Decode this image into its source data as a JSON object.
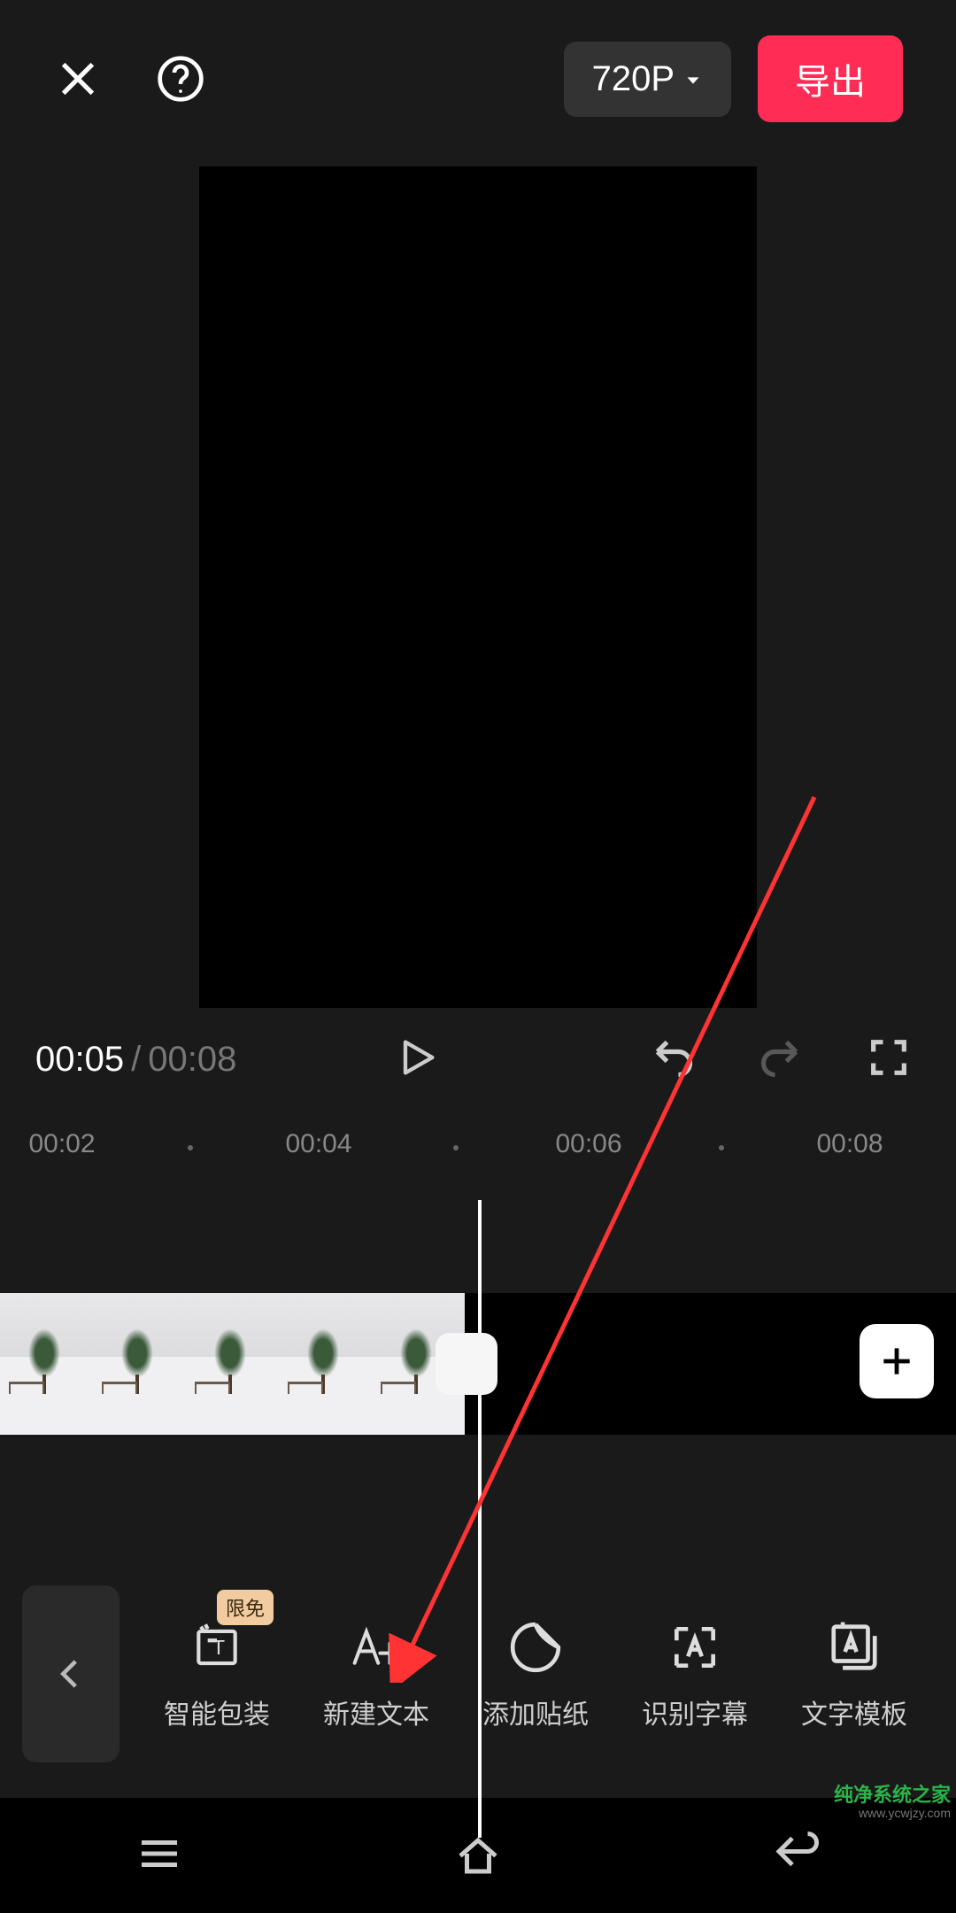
{
  "header": {
    "resolution_label": "720P",
    "export_label": "导出"
  },
  "playback": {
    "current_time": "00:05",
    "separator": "/",
    "total_time": "00:08"
  },
  "ruler": {
    "marks": [
      "00:02",
      "00:04",
      "00:06",
      "00:08"
    ]
  },
  "tools": {
    "badge": "限免",
    "items": [
      {
        "label": "智能包装",
        "icon": "smart-package-icon"
      },
      {
        "label": "新建文本",
        "icon": "new-text-icon"
      },
      {
        "label": "添加贴纸",
        "icon": "sticker-icon"
      },
      {
        "label": "识别字幕",
        "icon": "subtitle-icon"
      },
      {
        "label": "文字模板",
        "icon": "text-template-icon"
      }
    ]
  },
  "watermark": {
    "line1": "纯净系统之家",
    "line2": "www.ycwjzy.com"
  },
  "colors": {
    "accent": "#ff2d55",
    "badge_bg": "#f2cba0",
    "bg": "#1a1a1a"
  }
}
